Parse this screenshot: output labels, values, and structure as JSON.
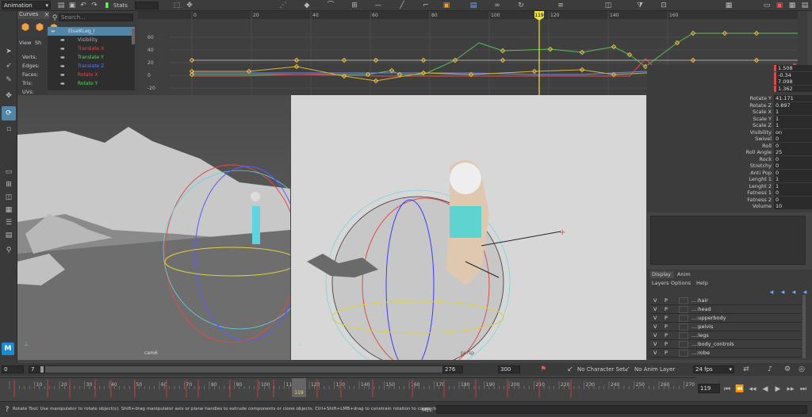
{
  "topbar": {
    "mode": "Animation",
    "stats": "Stats"
  },
  "graph_editor": {
    "tab_label": "Curves",
    "search_placeholder": "Search...",
    "outliner_items": [
      {
        "label": "ElsaIKLeg_l",
        "color": "#cfe3ff",
        "selected": true
      },
      {
        "label": "Visibility",
        "color": "#aaaaaa"
      },
      {
        "label": "Translate X",
        "color": "#e04a4a"
      },
      {
        "label": "Translate Y",
        "color": "#5fd35f"
      },
      {
        "label": "Translate Z",
        "color": "#5a7cff"
      },
      {
        "label": "Rotate X",
        "color": "#e04a4a"
      },
      {
        "label": "Rotate Y",
        "color": "#5fd35f"
      }
    ],
    "ruler_ticks": [
      "0",
      "20",
      "40",
      "60",
      "80",
      "100",
      "120",
      "140",
      "160"
    ],
    "y_ticks": [
      "60",
      "40",
      "20",
      "0",
      "-20"
    ],
    "current_frame": "119"
  },
  "left_panel": {
    "tabs": [
      "View",
      "Sh"
    ],
    "stats_labels": [
      "Verts:",
      "Edges:",
      "Faces:",
      "Tris:",
      "UVs:"
    ]
  },
  "viewports": {
    "left_camera_label": "cam6",
    "right_camera_label": "persp"
  },
  "channel_box": {
    "top_values": [
      "1.508",
      "-0.34",
      "7.098",
      "1.362"
    ],
    "attributes": [
      {
        "name": "Rotate Y",
        "value": "41.171"
      },
      {
        "name": "Rotate Z",
        "value": "0.897"
      },
      {
        "name": "Scale X",
        "value": "1"
      },
      {
        "name": "Scale Y",
        "value": "1"
      },
      {
        "name": "Scale Z",
        "value": "1"
      },
      {
        "name": "Visibility",
        "value": "on"
      },
      {
        "name": "Swivel",
        "value": "0"
      },
      {
        "name": "Roll",
        "value": "0"
      },
      {
        "name": "Roll Angle",
        "value": "25"
      },
      {
        "name": "Rock",
        "value": "0"
      },
      {
        "name": "Stretchy",
        "value": "0"
      },
      {
        "name": "Anti Pop",
        "value": "0"
      },
      {
        "name": "Lenght 1",
        "value": "1"
      },
      {
        "name": "Lenght 2",
        "value": "1"
      },
      {
        "name": "Fatness 1",
        "value": "0"
      },
      {
        "name": "Fatness 2",
        "value": "0"
      },
      {
        "name": "Volume",
        "value": "10"
      }
    ]
  },
  "layer_editor": {
    "tabs": [
      "Display",
      "Anim"
    ],
    "menu": [
      "Layers",
      "Options",
      "Help"
    ],
    "layers": [
      {
        "v": "V",
        "p": "P",
        "name": "...:hair"
      },
      {
        "v": "V",
        "p": "P",
        "name": "...:head"
      },
      {
        "v": "V",
        "p": "P",
        "name": "...:upperbody"
      },
      {
        "v": "V",
        "p": "P",
        "name": "...:pelvis"
      },
      {
        "v": "V",
        "p": "P",
        "name": "...:legs"
      },
      {
        "v": "V",
        "p": "P",
        "name": "...:body_controls"
      },
      {
        "v": "V",
        "p": "P",
        "name": "...:robe"
      }
    ]
  },
  "range_slider": {
    "start": "0",
    "range_start": "7",
    "range_end": "276",
    "end": "300",
    "character_set": "No Character Set",
    "anim_layer": "No Anim Layer",
    "fps": "24 fps"
  },
  "timeline": {
    "ticks": [
      "10",
      "20",
      "30",
      "40",
      "50",
      "60",
      "70",
      "80",
      "90",
      "100",
      "110",
      "120",
      "130",
      "140",
      "150",
      "160",
      "170",
      "180",
      "190",
      "200",
      "210",
      "220",
      "230",
      "240",
      "250",
      "260",
      "270"
    ],
    "current_frame": "119",
    "current_frame_field": "119"
  },
  "status": {
    "help_line": "Rotate Tool: Use manipulator to rotate object(s). Shift+drag manipulator axis or plane handles to extrude components or clone objects. Ctrl+Shift+LMB+drag to constrain rotation to connected edges. Use D or INSE",
    "mel_label": "MEL"
  }
}
